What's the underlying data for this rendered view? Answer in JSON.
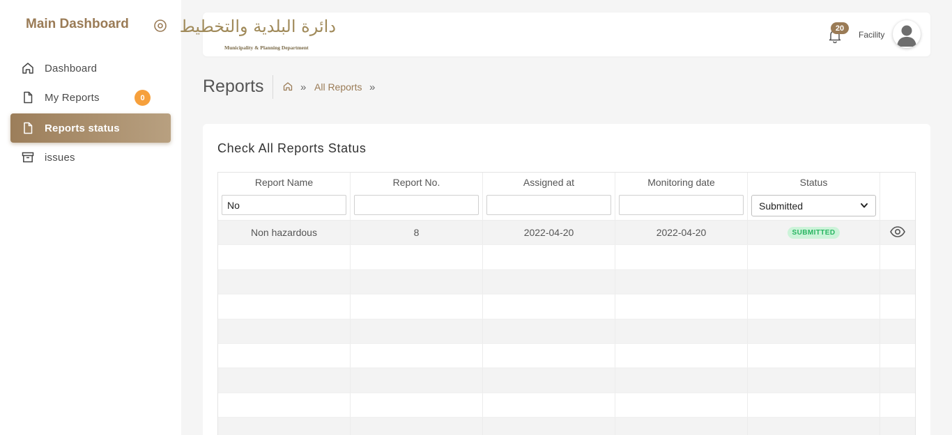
{
  "sidebar": {
    "brand": "Main Dashboard",
    "items": [
      {
        "label": "Dashboard",
        "icon": "home-icon"
      },
      {
        "label": "My Reports",
        "icon": "file-icon",
        "badge": "0"
      },
      {
        "label": "Reports status",
        "icon": "file-icon",
        "active": true
      },
      {
        "label": "issues",
        "icon": "archive-icon"
      }
    ]
  },
  "topbar": {
    "logo_ar": "دائرة البلدية والتخطيط",
    "logo_en": "Municipality & Planning Department",
    "notifications": "20",
    "user_role": "Facility"
  },
  "page": {
    "title": "Reports",
    "breadcrumb": {
      "link": "All Reports",
      "sep": "»"
    }
  },
  "card": {
    "title": "Check All Reports Status",
    "columns": [
      "Report Name",
      "Report No.",
      "Assigned at",
      "Monitoring date",
      "Status"
    ],
    "filters": {
      "report_name": "No",
      "report_no": "",
      "assigned_at": "",
      "monitoring_date": "",
      "status": "Submitted"
    },
    "rows": [
      {
        "name": "Non hazardous",
        "no": "8",
        "assigned": "2022-04-20",
        "monitoring": "2022-04-20",
        "status": "SUBMITTED"
      }
    ]
  },
  "colors": {
    "accent": "#9a7b56",
    "badge_orange": "#f6a03c",
    "status_green": "#28b561",
    "status_green_bg": "#ccf3d9"
  }
}
